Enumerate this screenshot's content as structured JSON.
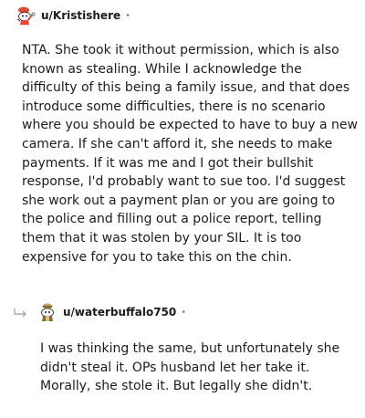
{
  "comments": [
    {
      "username": "u/Kristishere",
      "separator": "•",
      "body": "NTA. She took it without permission, which is also known as stealing. While I acknowledge the difficulty of this being a family issue, and that does introduce some difficulties, there is no scenario where you should be expected to have to buy a new camera. If she can't afford it, she needs to make payments. If it was me and I got their bullshit response, I'd probably want to sue too. I'd suggest she work out a payment plan or you are going to the police and filling out a police report, telling them that it was stolen by your SIL. It is too expensive for you to take this on the chin."
    },
    {
      "username": "u/waterbuffalo750",
      "separator": "•",
      "body": "I was thinking the same, but unfortunately she didn't steal it. OPs husband let her take it. Morally, she stole it. But legally she didn't."
    }
  ],
  "colors": {
    "text": "#1c1c1c",
    "meta": "#878a8c",
    "avatar_red": "#e64b2e",
    "avatar_brown": "#8a6a2e"
  },
  "icons": {
    "avatar_1": "snoo-avatar-icon",
    "avatar_2": "snoo-avatar-icon",
    "reply_arrow": "reply-arrow-icon"
  }
}
